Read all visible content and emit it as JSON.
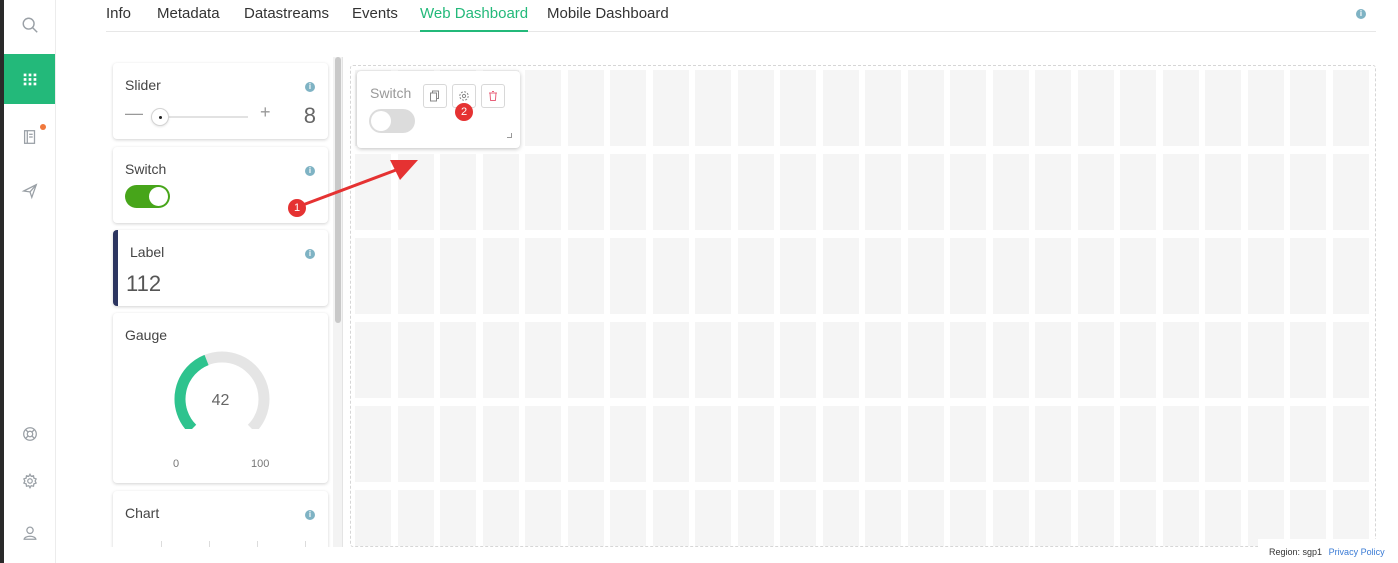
{
  "rail": {
    "items": [
      {
        "icon": "search-icon"
      },
      {
        "icon": "grid-icon",
        "active": true
      },
      {
        "icon": "book-icon",
        "notification": true
      },
      {
        "icon": "send-icon"
      },
      {
        "icon": "help-ring-icon"
      },
      {
        "icon": "gear-icon"
      },
      {
        "icon": "user-icon"
      }
    ]
  },
  "tabs": [
    {
      "label": "Info"
    },
    {
      "label": "Metadata"
    },
    {
      "label": "Datastreams"
    },
    {
      "label": "Events"
    },
    {
      "label": "Web Dashboard",
      "active": true
    },
    {
      "label": "Mobile Dashboard"
    }
  ],
  "palette": {
    "slider": {
      "title": "Slider",
      "minus": "—",
      "plus": "+",
      "value": "8"
    },
    "switch": {
      "title": "Switch",
      "state": "on"
    },
    "label": {
      "title": "Label",
      "value": "112"
    },
    "gauge": {
      "title": "Gauge",
      "value": "42",
      "min": "0",
      "max": "100",
      "fraction": 0.42
    },
    "chart": {
      "title": "Chart"
    }
  },
  "canvas": {
    "widget": {
      "title": "Switch",
      "state": "off",
      "actions": [
        "copy-icon",
        "gear-icon",
        "trash-icon"
      ]
    }
  },
  "annotations": {
    "marker_1": "1",
    "marker_2": "2",
    "arrow_color": "#e53232"
  },
  "colors": {
    "accent": "#23b97a",
    "toggle_on": "#47a51a",
    "label_bar": "#2c3560"
  },
  "footer": {
    "region": "Region: sgp1",
    "privacy": "Privacy Policy"
  }
}
